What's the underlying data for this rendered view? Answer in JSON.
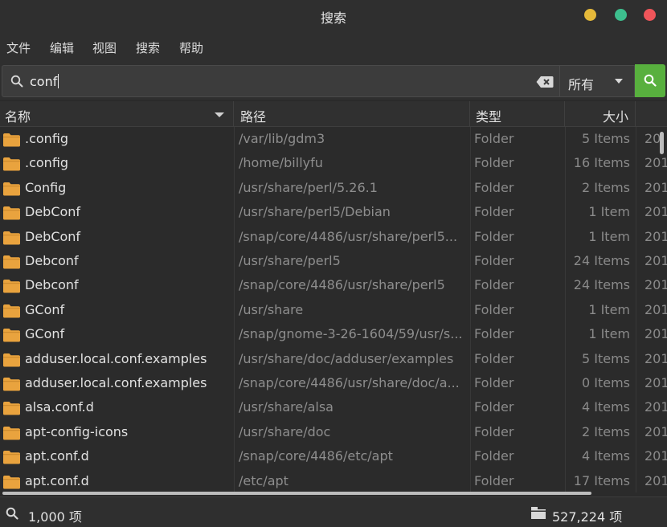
{
  "window": {
    "title": "搜索"
  },
  "menu": [
    "文件",
    "编辑",
    "视图",
    "搜索",
    "帮助"
  ],
  "search": {
    "query": "conf",
    "scope": "所有"
  },
  "columns": {
    "name": "名称",
    "path": "路径",
    "type": "类型",
    "size": "大小"
  },
  "rows": [
    {
      "name": ".config",
      "path": "/var/lib/gdm3",
      "type": "Folder",
      "size": "5 Items",
      "date": "20"
    },
    {
      "name": ".config",
      "path": "/home/billyfu",
      "type": "Folder",
      "size": "16 Items",
      "date": "201"
    },
    {
      "name": "Config",
      "path": "/usr/share/perl/5.26.1",
      "type": "Folder",
      "size": "2 Items",
      "date": "201"
    },
    {
      "name": "DebConf",
      "path": "/usr/share/perl5/Debian",
      "type": "Folder",
      "size": "1 Item",
      "date": "201"
    },
    {
      "name": "DebConf",
      "path": "/snap/core/4486/usr/share/perl5...",
      "type": "Folder",
      "size": "1 Item",
      "date": "201"
    },
    {
      "name": "Debconf",
      "path": "/usr/share/perl5",
      "type": "Folder",
      "size": "24 Items",
      "date": "201"
    },
    {
      "name": "Debconf",
      "path": "/snap/core/4486/usr/share/perl5",
      "type": "Folder",
      "size": "24 Items",
      "date": "201"
    },
    {
      "name": "GConf",
      "path": "/usr/share",
      "type": "Folder",
      "size": "1 Item",
      "date": "201"
    },
    {
      "name": "GConf",
      "path": "/snap/gnome-3-26-1604/59/usr/s...",
      "type": "Folder",
      "size": "1 Item",
      "date": "201"
    },
    {
      "name": "adduser.local.conf.examples",
      "path": "/usr/share/doc/adduser/examples",
      "type": "Folder",
      "size": "5 Items",
      "date": "201"
    },
    {
      "name": "adduser.local.conf.examples",
      "path": "/snap/core/4486/usr/share/doc/a...",
      "type": "Folder",
      "size": "0 Items",
      "date": "201"
    },
    {
      "name": "alsa.conf.d",
      "path": "/usr/share/alsa",
      "type": "Folder",
      "size": "4 Items",
      "date": "201"
    },
    {
      "name": "apt-config-icons",
      "path": "/usr/share/doc",
      "type": "Folder",
      "size": "2 Items",
      "date": "201"
    },
    {
      "name": "apt.conf.d",
      "path": "/snap/core/4486/etc/apt",
      "type": "Folder",
      "size": "4 Items",
      "date": "201"
    },
    {
      "name": "apt.conf.d",
      "path": "/etc/apt",
      "type": "Folder",
      "size": "17 Items",
      "date": "201"
    }
  ],
  "status": {
    "count": "1,000 项",
    "size": "527,224 项"
  },
  "colors": {
    "folder": "#e9a33e",
    "accent": "#58b03e"
  }
}
